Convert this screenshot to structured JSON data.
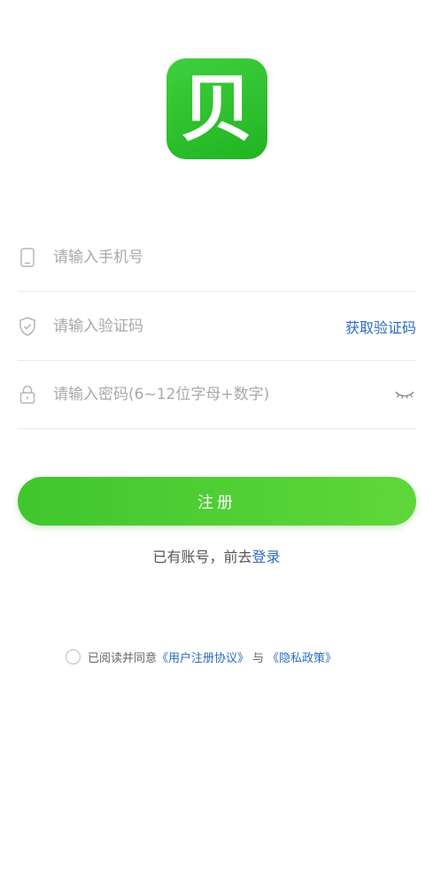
{
  "app": {
    "logo_char": "贝",
    "brand_color": "#2fc42f",
    "link_color": "#2b6cc4"
  },
  "form": {
    "phone": {
      "placeholder": "请输入手机号",
      "icon": "phone-icon"
    },
    "code": {
      "placeholder": "请输入验证码",
      "icon": "shield-icon",
      "get_code_label": "获取验证码"
    },
    "password": {
      "placeholder": "请输入密码(6~12位字母+数字)",
      "icon": "lock-icon",
      "toggle_icon": "eye-closed-icon"
    }
  },
  "register_button": {
    "label": "注册"
  },
  "login_prompt": {
    "text": "已有账号，前去",
    "link": "登录"
  },
  "agreement": {
    "prefix": "已阅读并同意",
    "user_agreement": "《用户注册协议》",
    "connector": "与",
    "privacy_policy": "《隐私政策》"
  }
}
